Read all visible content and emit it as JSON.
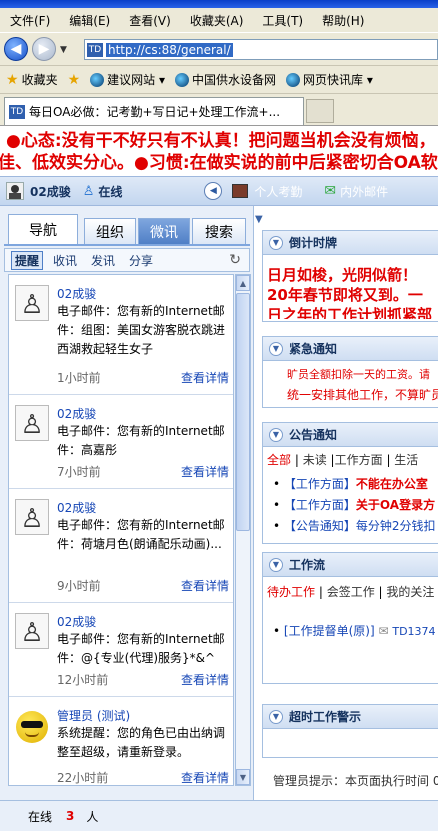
{
  "browser": {
    "menu": [
      "文件(F)",
      "编辑(E)",
      "查看(V)",
      "收藏夹(A)",
      "工具(T)",
      "帮助(H)"
    ],
    "address": "http://cs:88/general/",
    "favorites_label": "收藏夹",
    "favorites": [
      "建议网站 ▾",
      "中国供水设备网",
      "网页快讯库 ▾"
    ],
    "tab_title": "每日OA必做：记考勤+写日记+处理工作流+..."
  },
  "marquee": {
    "line1": "●心态:没有干不好只有不认真！把问题当机会没有烦恼，",
    "line2": "佳、低效实分心。●习惯:在做实说的前中后紧密切合OA软"
  },
  "userbar": {
    "user": "02成骏",
    "online": "在线",
    "attendance": "个人考勤",
    "mail": "内外邮件"
  },
  "left_tabs": {
    "top": [
      "导航",
      "组织",
      "微讯",
      "搜索"
    ],
    "sub": [
      "提醒",
      "收讯",
      "发讯",
      "分享"
    ]
  },
  "messages": [
    {
      "who": "02成骏",
      "body": "电子邮件：您有新的Internet邮件：组图：美国女游客脱衣跳进西湖救起轻生女子",
      "time": "1小时前",
      "link": "查看详情"
    },
    {
      "who": "02成骏",
      "body": "电子邮件：您有新的Internet邮件：高嘉彤",
      "time": "7小时前",
      "link": "查看详情"
    },
    {
      "who": "02成骏",
      "body": "电子邮件：您有新的Internet邮件：荷塘月色(朗诵配乐动画)...",
      "time": "9小时前",
      "link": "查看详情"
    },
    {
      "who": "02成骏",
      "body": "电子邮件：您有新的Internet邮件：@{专业(代理)服务}*&^",
      "time": "12小时前",
      "link": "查看详情"
    },
    {
      "who": "管理员 (测试)",
      "body": "系统提醒：您的角色已由出纳调整至超级，请重新登录。",
      "time": "22小时前",
      "link": "查看详情"
    }
  ],
  "panels": {
    "countdown": {
      "title": "倒计时牌",
      "text": "日月如梭，光阴似箭！20年春节即将又到。一日之年的工作计划抓紧部署"
    },
    "urgent": {
      "title": "紧急通知",
      "lines": [
        "旷员全额扣除一天的工资。请",
        "统一安排其他工作，不算旷员"
      ]
    },
    "notice": {
      "title": "公告通知",
      "filters": [
        "全部",
        "未读",
        "工作方面",
        "生活"
      ],
      "items": [
        {
          "tag": "【工作方面】",
          "text": "不能在办公室"
        },
        {
          "tag": "【工作方面】",
          "text": "关于OA登录方"
        },
        {
          "tag": "【公告通知】",
          "text": "每分钟2分钱扣"
        }
      ]
    },
    "workflow": {
      "title": "工作流",
      "filters": [
        "待办工作",
        "会签工作",
        "我的关注"
      ],
      "item": "[工作提督单(原)]",
      "item_id": "TD1374"
    },
    "timeout": {
      "title": "超时工作警示"
    }
  },
  "admin_tip": "管理员提示：本页面执行时间 0",
  "status": {
    "label": "在线",
    "count": "3",
    "unit": "人"
  },
  "colors": {
    "accent": "#1747b6",
    "alert": "#e00000",
    "panel_border": "#a5bfe0"
  }
}
